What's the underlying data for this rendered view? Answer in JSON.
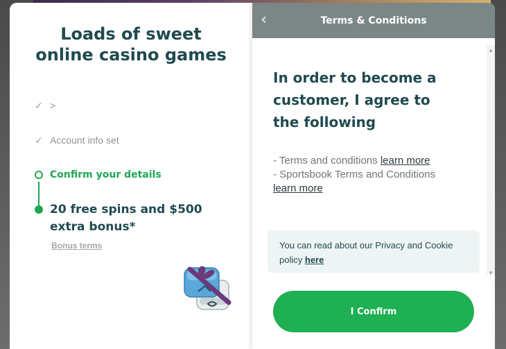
{
  "left": {
    "headline_line1": "Loads of sweet",
    "headline_line2": "online casino games",
    "steps": [
      {
        "label": ">"
      },
      {
        "label": "Account info set"
      },
      {
        "label": "Confirm your details"
      }
    ],
    "bonus_line1": "20 free spins and $500",
    "bonus_line2": "extra bonus*",
    "bonus_terms_label": "Bonus terms"
  },
  "right": {
    "header_title": "Terms & Conditions",
    "agree_line1": "In order to become a",
    "agree_line2": "customer, I agree to",
    "agree_line3": "the following",
    "terms": [
      {
        "prefix": "- Terms and conditions",
        "link": "learn more"
      },
      {
        "prefix": "- Sportsbook Terms and Conditions",
        "link": "learn more"
      }
    ],
    "privacy_text": "You can read about our Privacy and Cookie policy",
    "privacy_link": "here",
    "confirm_label": "I Confirm"
  },
  "colors": {
    "accent_green": "#1eb052",
    "heading_teal": "#1f4a4f",
    "header_gray": "#7b8786"
  },
  "icons": [
    "check-icon",
    "chevron-left-icon",
    "gift-icon"
  ]
}
